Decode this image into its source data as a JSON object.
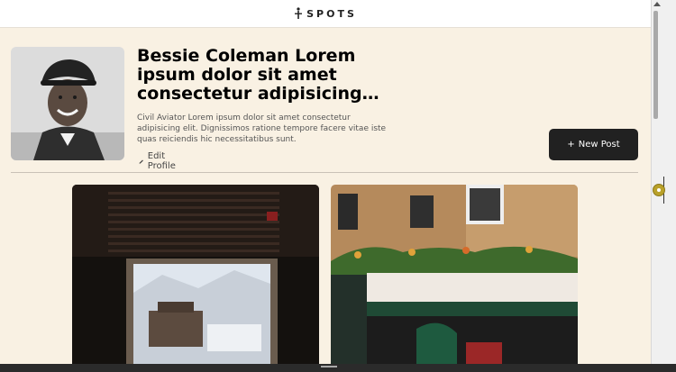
{
  "header": {
    "logo_text": "SPOTS",
    "logo_icon": "logo-icon"
  },
  "profile": {
    "name": "Bessie Coleman Lorem ipsum dolor sit amet consectetur adipisicing elit.",
    "description": "Civil Aviator Lorem ipsum dolor sit amet consectetur adipisicing elit. Dignissimos ratione tempore facere vitae iste quas reiciendis hic necessitatibus sunt.",
    "edit_label": "Edit Profile",
    "edit_icon": "pencil-icon"
  },
  "actions": {
    "new_post_label": "New Post",
    "new_post_icon": "plus-icon"
  },
  "cards": [
    {
      "name": "card-window-view"
    },
    {
      "name": "card-restaurant"
    }
  ],
  "colors": {
    "background": "#f9f1e3",
    "button": "#212121",
    "text": "#000000"
  }
}
